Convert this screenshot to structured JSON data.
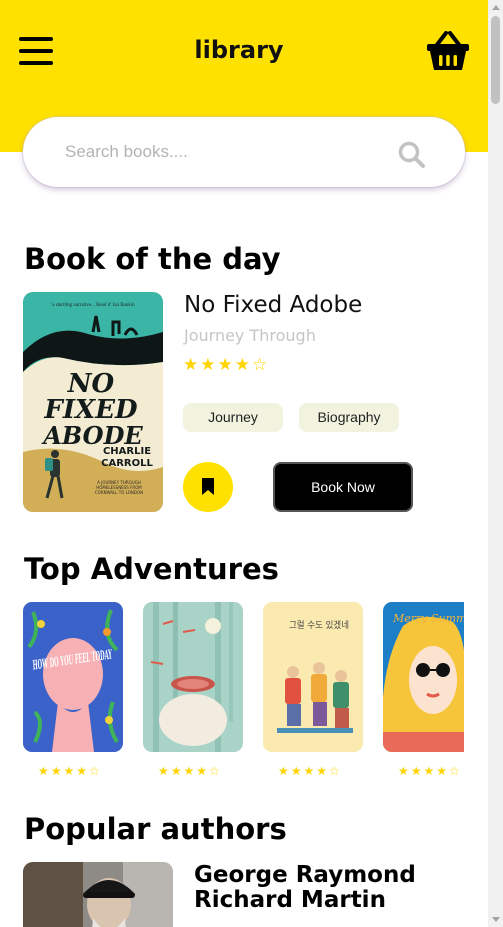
{
  "header": {
    "title": "library",
    "menu_icon": "hamburger-menu-icon",
    "cart_icon": "shopping-basket-icon",
    "accent_color": "#ffe100"
  },
  "search": {
    "placeholder": "Search books....",
    "icon": "search-icon"
  },
  "book_of_the_day": {
    "section_title": "Book of the day",
    "title": "No Fixed Adobe",
    "subtitle": "Journey Through",
    "rating": 4,
    "rating_stars": "★★★★☆",
    "tags": [
      "Journey",
      "Biography"
    ],
    "bookmark_icon": "bookmark-icon",
    "book_now_label": "Book Now",
    "cover": {
      "tagline": "'a startling narrative... Read it' Ian Rankin",
      "title_lines": [
        "NO",
        "FIXED",
        "ABODE"
      ],
      "author_lines": [
        "CHARLIE",
        "CARROLL"
      ],
      "blurb_lines": [
        "A JOURNEY THROUGH",
        "HOMELESSNESS FROM",
        "CORNWALL TO LONDON"
      ]
    }
  },
  "top_adventures": {
    "section_title": "Top Adventures",
    "books": [
      {
        "cover_text": "HOW DO YOU FEEL TODAY",
        "rating": 4,
        "rating_stars": "★★★★☆"
      },
      {
        "cover_text": "",
        "rating": 4,
        "rating_stars": "★★★★☆"
      },
      {
        "cover_text": "그럴 수도 있겠네",
        "rating": 4,
        "rating_stars": "★★★★☆"
      },
      {
        "cover_text": "Merry Summer",
        "rating": 4,
        "rating_stars": "★★★★☆"
      }
    ]
  },
  "popular_authors": {
    "section_title": "Popular authors",
    "authors": [
      {
        "name": "George Raymond Richard Martin"
      }
    ]
  }
}
